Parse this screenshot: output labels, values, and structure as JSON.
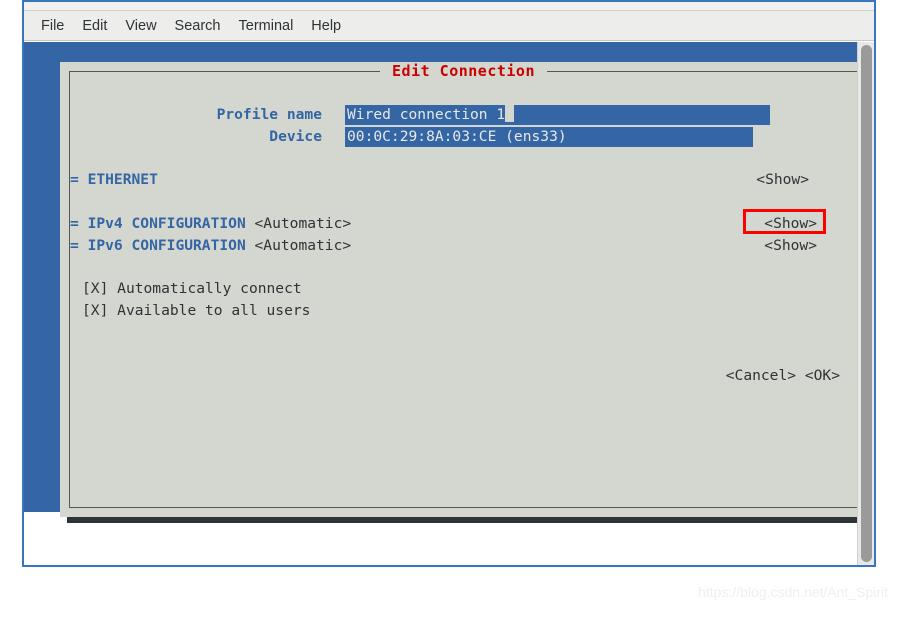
{
  "window": {
    "menu": [
      {
        "label": "File"
      },
      {
        "label": "Edit"
      },
      {
        "label": "View"
      },
      {
        "label": "Search"
      },
      {
        "label": "Terminal"
      },
      {
        "label": "Help"
      }
    ]
  },
  "dialog": {
    "title": "Edit Connection",
    "fields": [
      {
        "label": "Profile name",
        "value": "Wired connection 1"
      },
      {
        "label": "Device",
        "value": "00:0C:29:8A:03:CE (ens33)"
      }
    ],
    "sections": [
      {
        "marker": "=",
        "label": "ETHERNET",
        "value": "",
        "action": "<Show>",
        "highlighted": false
      },
      {
        "marker": "=",
        "label": "IPv4 CONFIGURATION",
        "value": "<Automatic>",
        "action": "<Show>",
        "highlighted": true
      },
      {
        "marker": "=",
        "label": "IPv6 CONFIGURATION",
        "value": "<Automatic>",
        "action": "<Show>",
        "highlighted": false
      }
    ],
    "checkboxes": [
      {
        "box": "[X]",
        "label": "Automatically connect"
      },
      {
        "box": "[X]",
        "label": "Available to all users"
      }
    ],
    "buttons": [
      {
        "label": "<Cancel>"
      },
      {
        "label": "<OK>"
      }
    ]
  },
  "watermark": {
    "text": "https://blog.csdn.net/Ant_Spirit"
  },
  "colors": {
    "terminal_blue": "#3465a4",
    "dialog_bg": "#d3d7cf",
    "title_red": "#cc0000",
    "highlight_red": "#ff0000",
    "text_dark": "#2e3436",
    "selection_fg": "#e8e8e6"
  }
}
